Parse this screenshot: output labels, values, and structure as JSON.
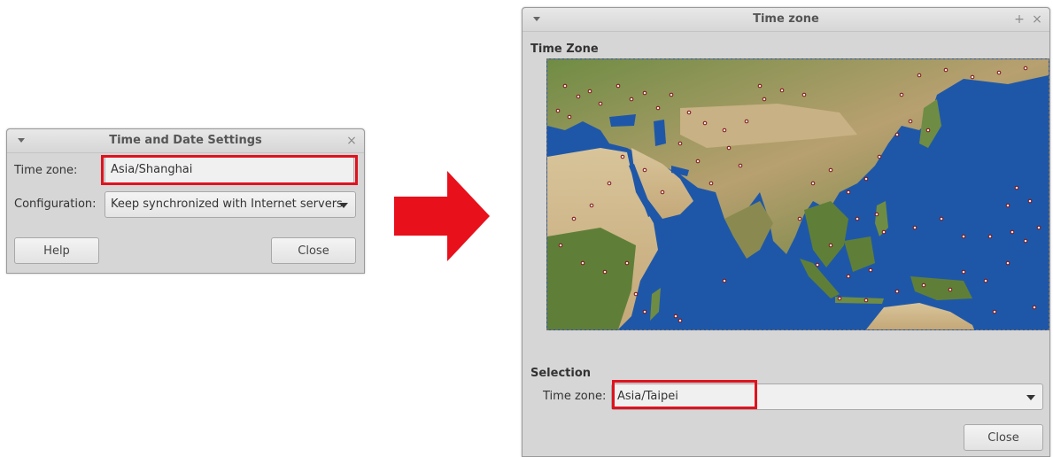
{
  "left_dialog": {
    "title": "Time and Date Settings",
    "close_glyph": "×",
    "timezone_label": "Time zone:",
    "timezone_value": "Asia/Shanghai",
    "configuration_label": "Configuration:",
    "configuration_value": "Keep synchronized with Internet servers",
    "help_label": "Help",
    "close_label": "Close"
  },
  "right_dialog": {
    "title": "Time zone",
    "maximize_glyph": "+",
    "close_glyph": "×",
    "map_section_title": "Time Zone",
    "selection_title": "Selection",
    "timezone_label": "Time zone:",
    "timezone_value": "Asia/Taipei",
    "close_label": "Close"
  },
  "colors": {
    "highlight": "#e0121f",
    "arrow": "#e8101b",
    "ocean": "#1f57a8",
    "land": "#8a9a55"
  },
  "icons": [
    "window-menu-icon",
    "close-icon",
    "maximize-icon",
    "dropdown-caret-icon",
    "arrow-right-icon",
    "world-map"
  ]
}
